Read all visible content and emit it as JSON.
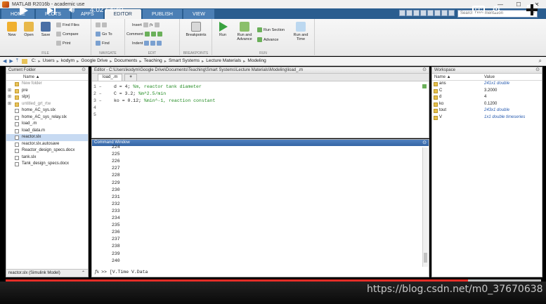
{
  "window": {
    "title": "MATLAB R2016b - academic use",
    "buttons": [
      "—",
      "☐",
      "✕"
    ]
  },
  "tabs": [
    {
      "label": "HOME",
      "active": false
    },
    {
      "label": "PLOTS",
      "active": false
    },
    {
      "label": "APPS",
      "active": false
    },
    {
      "label": "EDITOR",
      "active": true
    },
    {
      "label": "PUBLISH",
      "active": false
    },
    {
      "label": "VIEW",
      "active": false
    }
  ],
  "search_docs": {
    "placeholder": "Search Documentation"
  },
  "ribbon": {
    "file": {
      "label": "FILE",
      "new": "New",
      "open": "Open",
      "save": "Save",
      "find_files": "Find Files",
      "compare": "Compare",
      "print": "Print"
    },
    "navigate": {
      "label": "NAVIGATE",
      "go_to": "Go To",
      "find": "Find"
    },
    "edit": {
      "label": "EDIT",
      "insert": "Insert",
      "comment": "Comment",
      "indent": "Indent",
      "fx": "fx"
    },
    "breakpoints": {
      "label": "BREAKPOINTS",
      "breakpoints": "Breakpoints"
    },
    "run": {
      "label": "RUN",
      "run": "Run",
      "run_and_advance": "Run and\nAdvance",
      "run_section": "Run Section",
      "advance": "Advance",
      "run_and_time": "Run and\nTime"
    }
  },
  "address": {
    "path": [
      "C:",
      "Users",
      "kodym",
      "Google Drive",
      "Documents",
      "Teaching",
      "Smart Systems",
      "Lecture Materials",
      "Modeling"
    ]
  },
  "current_folder": {
    "title": "Current Folder",
    "col_name": "Name ▲",
    "items": [
      {
        "name": "New folder",
        "type": "folder",
        "expand": false,
        "dim": true
      },
      {
        "name": "pre",
        "type": "folder",
        "expand": true,
        "dim": false
      },
      {
        "name": "slprj",
        "type": "folder",
        "expand": true,
        "dim": false
      },
      {
        "name": "untitled_grt_rtw",
        "type": "folder",
        "expand": true,
        "dim": true
      },
      {
        "name": "home_AC_sys.slx",
        "type": "file",
        "expand": false,
        "dim": false
      },
      {
        "name": "home_AC_sys_relay.slx",
        "type": "file",
        "expand": false,
        "dim": false
      },
      {
        "name": "load_.m",
        "type": "file",
        "expand": false,
        "dim": false
      },
      {
        "name": "load_data.m",
        "type": "file",
        "expand": false,
        "dim": false
      },
      {
        "name": "reactor.slx",
        "type": "file",
        "expand": false,
        "dim": false,
        "selected": true
      },
      {
        "name": "reactor.slx.autosave",
        "type": "file",
        "expand": false,
        "dim": false
      },
      {
        "name": "Reactor_design_specs.docx",
        "type": "file",
        "expand": false,
        "dim": false
      },
      {
        "name": "tank.slx",
        "type": "file",
        "expand": false,
        "dim": false
      },
      {
        "name": "Tank_design_specs.docx",
        "type": "file",
        "expand": false,
        "dim": false
      }
    ],
    "details": "reactor.slx  (Simulink Model)"
  },
  "editor": {
    "title": "Editor - C:\\Users\\kodym\\Google Drive\\Documents\\Teaching\\Smart Systems\\Lecture Materials\\Modeling\\load_.m",
    "tabs": [
      "load_.m",
      "+"
    ],
    "lines": [
      {
        "num": "1 –",
        "code": "d = 4; ",
        "comment": "%m, reactor tank diameter"
      },
      {
        "num": "2 –",
        "code": "C = 3.2; ",
        "comment": "%m^2.5/min"
      },
      {
        "num": "3 –",
        "code": "ko = 0.12; ",
        "comment": "%min^-1, reaction constant"
      },
      {
        "num": "4",
        "code": "",
        "comment": ""
      },
      {
        "num": "5",
        "code": "",
        "comment": ""
      }
    ]
  },
  "command_window": {
    "title": "Command Window",
    "output": [
      "224",
      "225",
      "226",
      "227",
      "228",
      "229",
      "230",
      "231",
      "232",
      "233",
      "234",
      "235",
      "236",
      "237",
      "238",
      "239",
      "240"
    ],
    "prompt": ">>",
    "fx": "fx",
    "input": "[V.Time V.Data"
  },
  "workspace": {
    "title": "Workspace",
    "col_name": "Name ▲",
    "col_value": "Value",
    "vars": [
      {
        "name": "ans",
        "value": "241x1 double",
        "italic": true
      },
      {
        "name": "C",
        "value": "3.2000",
        "italic": false
      },
      {
        "name": "d",
        "value": "4",
        "italic": false
      },
      {
        "name": "ko",
        "value": "0.1200",
        "italic": false
      },
      {
        "name": "tout",
        "value": "243x1 double",
        "italic": true
      },
      {
        "name": "V",
        "value": "1x1 double timeseries",
        "italic": true
      }
    ]
  },
  "video": {
    "time": "4:02 / 4:40",
    "progress": 0.864,
    "buffered_end": 1.0,
    "watermark": "https://blog.csdn.net/m0_37670638"
  },
  "colors": {
    "accent": "#2a5d8f",
    "progress_played": "#e52d27",
    "cmd_header": "#3565a4"
  }
}
